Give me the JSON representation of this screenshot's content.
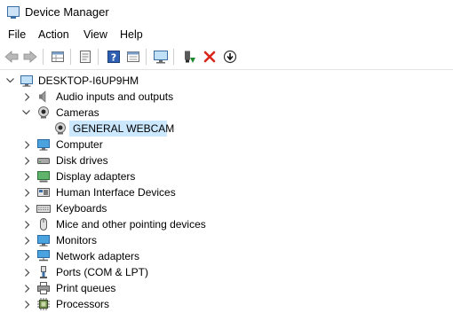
{
  "window": {
    "title": "Device Manager"
  },
  "menu": [
    "File",
    "Action",
    "View",
    "Help"
  ],
  "toolbar": {
    "buttons": [
      "back-icon",
      "forward-icon",
      "properties-grid-icon",
      "show-hidden-icon",
      "help-icon",
      "view-resources-icon",
      "monitor-scan-icon",
      "enable-device-icon",
      "uninstall-icon",
      "update-driver-icon"
    ]
  },
  "tree": {
    "root": "DESKTOP-I6UP9HM",
    "nodes": [
      {
        "label": "Audio inputs and outputs",
        "icon": "speaker-icon",
        "expanded": false
      },
      {
        "label": "Cameras",
        "icon": "camera-icon",
        "expanded": true
      },
      {
        "label": "GENERAL WEBCAM",
        "icon": "webcam-icon",
        "child": true,
        "selected": true
      },
      {
        "label": "Computer",
        "icon": "computer-icon",
        "expanded": false
      },
      {
        "label": "Disk drives",
        "icon": "disk-icon",
        "expanded": false
      },
      {
        "label": "Display adapters",
        "icon": "display-adapter-icon",
        "expanded": false
      },
      {
        "label": "Human Interface Devices",
        "icon": "hid-icon",
        "expanded": false
      },
      {
        "label": "Keyboards",
        "icon": "keyboard-icon",
        "expanded": false
      },
      {
        "label": "Mice and other pointing devices",
        "icon": "mouse-icon",
        "expanded": false
      },
      {
        "label": "Monitors",
        "icon": "monitor-icon",
        "expanded": false
      },
      {
        "label": "Network adapters",
        "icon": "network-icon",
        "expanded": false
      },
      {
        "label": "Ports (COM & LPT)",
        "icon": "port-icon",
        "expanded": false
      },
      {
        "label": "Print queues",
        "icon": "printer-icon",
        "expanded": false
      },
      {
        "label": "Processors",
        "icon": "processor-icon",
        "expanded": false
      }
    ]
  },
  "colors": {
    "selection": "#cce8ff",
    "accent": "#3a6ea5",
    "uninstall_red": "#d9261c",
    "enable_green": "#1e8a2e"
  }
}
